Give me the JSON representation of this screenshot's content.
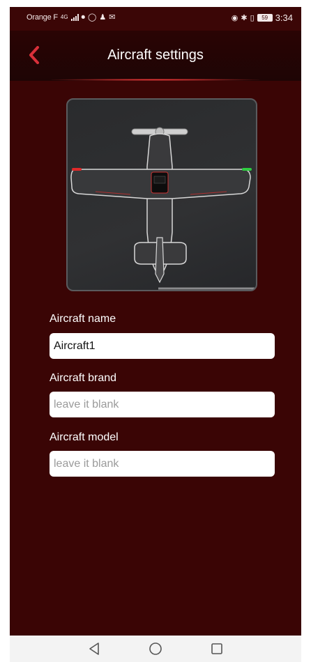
{
  "status_bar": {
    "carrier": "Orange F",
    "network": "4G",
    "battery": "59",
    "time": "3:34"
  },
  "header": {
    "title": "Aircraft settings",
    "back_icon": "chevron-left-icon"
  },
  "form": {
    "name_label": "Aircraft name",
    "name_value": "Aircraft1",
    "brand_label": "Aircraft brand",
    "brand_placeholder": "leave it blank",
    "model_label": "Aircraft model",
    "model_placeholder": "leave it blank"
  },
  "nav": {
    "back_icon": "triangle-back-icon",
    "home_icon": "circle-home-icon",
    "recents_icon": "square-recents-icon"
  },
  "colors": {
    "background": "#3a0505",
    "header": "#1e0505",
    "accent": "#d9303a",
    "wingtip_left": "#e02a2a",
    "wingtip_right": "#2ecc40"
  }
}
